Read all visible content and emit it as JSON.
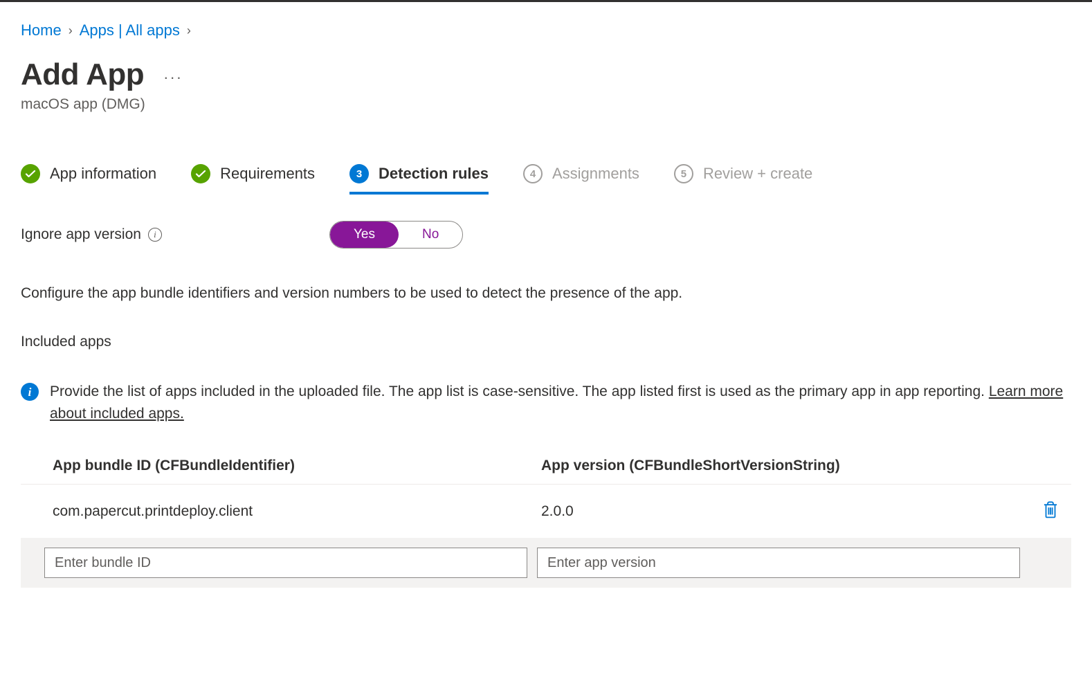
{
  "breadcrumb": {
    "home": "Home",
    "apps": "Apps | All apps"
  },
  "page": {
    "title": "Add App",
    "subtitle": "macOS app (DMG)"
  },
  "tabs": {
    "app_info": "App information",
    "requirements": "Requirements",
    "detection": "Detection rules",
    "detection_num": "3",
    "assignments": "Assignments",
    "assignments_num": "4",
    "review": "Review + create",
    "review_num": "5"
  },
  "form": {
    "ignore_version_label": "Ignore app version",
    "toggle_yes": "Yes",
    "toggle_no": "No"
  },
  "description": "Configure the app bundle identifiers and version numbers to be used to detect the presence of the app.",
  "included_apps_heading": "Included apps",
  "info_banner": {
    "text": "Provide the list of apps included in the uploaded file. The app list is case-sensitive. The app listed first is used as the primary app in app reporting.",
    "link": " Learn more about included apps."
  },
  "table": {
    "col_bundle": "App bundle ID (CFBundleIdentifier)",
    "col_version": "App version (CFBundleShortVersionString)",
    "rows": [
      {
        "bundle_id": "com.papercut.printdeploy.client",
        "version": "2.0.0"
      }
    ],
    "input_bundle_placeholder": "Enter bundle ID",
    "input_version_placeholder": "Enter app version"
  }
}
